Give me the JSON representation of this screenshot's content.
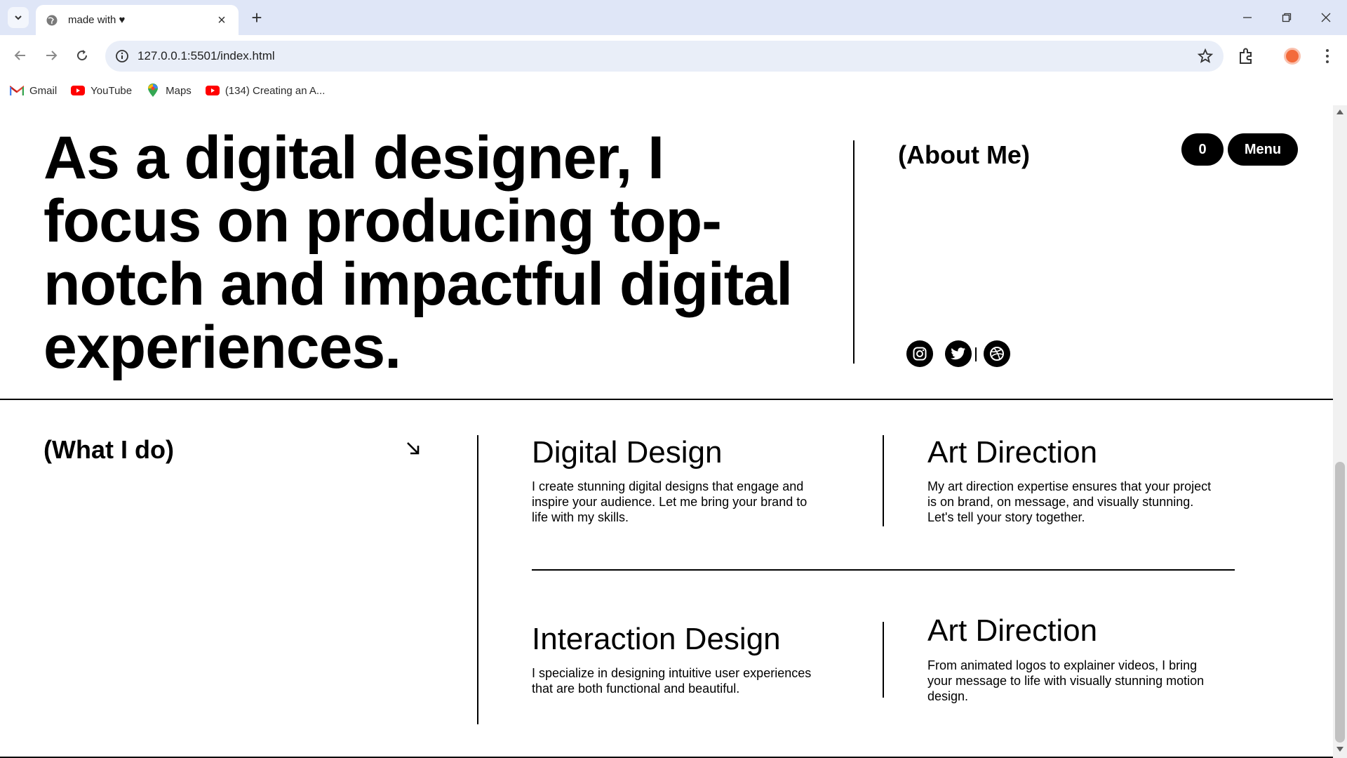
{
  "browser": {
    "tab_title": "made with ♥",
    "url": "127.0.0.1:5501/index.html",
    "bookmarks": [
      {
        "label": "Gmail",
        "icon": "gmail-icon"
      },
      {
        "label": "YouTube",
        "icon": "youtube-icon"
      },
      {
        "label": "Maps",
        "icon": "maps-icon"
      },
      {
        "label": "(134) Creating an A...",
        "icon": "youtube-icon"
      }
    ]
  },
  "hero": {
    "headline": "As a digital designer, I focus on producing top-notch and impactful digital experiences.",
    "about_label": "(About Me)",
    "count_label": "0",
    "menu_label": "Menu",
    "socials": [
      "instagram-icon",
      "twitter-icon",
      "dribbble-icon"
    ]
  },
  "services": {
    "section_label": "(What I do)",
    "items": [
      {
        "title": "Digital Design",
        "desc": "I create stunning digital designs that engage and inspire your audience. Let me bring your brand to life with my skills."
      },
      {
        "title": "Art Direction",
        "desc": "My art direction expertise ensures that your project is on brand, on message, and visually stunning. Let's tell your story together."
      },
      {
        "title": "Interaction Design",
        "desc": "I specialize in designing intuitive user experiences that are both functional and beautiful."
      },
      {
        "title": "Art Direction",
        "desc": "From animated logos to explainer videos, I bring your message to life with visually stunning motion design."
      }
    ]
  },
  "colors": {
    "tabbar_bg": "#dfe6f7",
    "omnibox_bg": "#e9eef8",
    "text": "#000000",
    "button_bg": "#000000",
    "button_text": "#ffffff"
  }
}
